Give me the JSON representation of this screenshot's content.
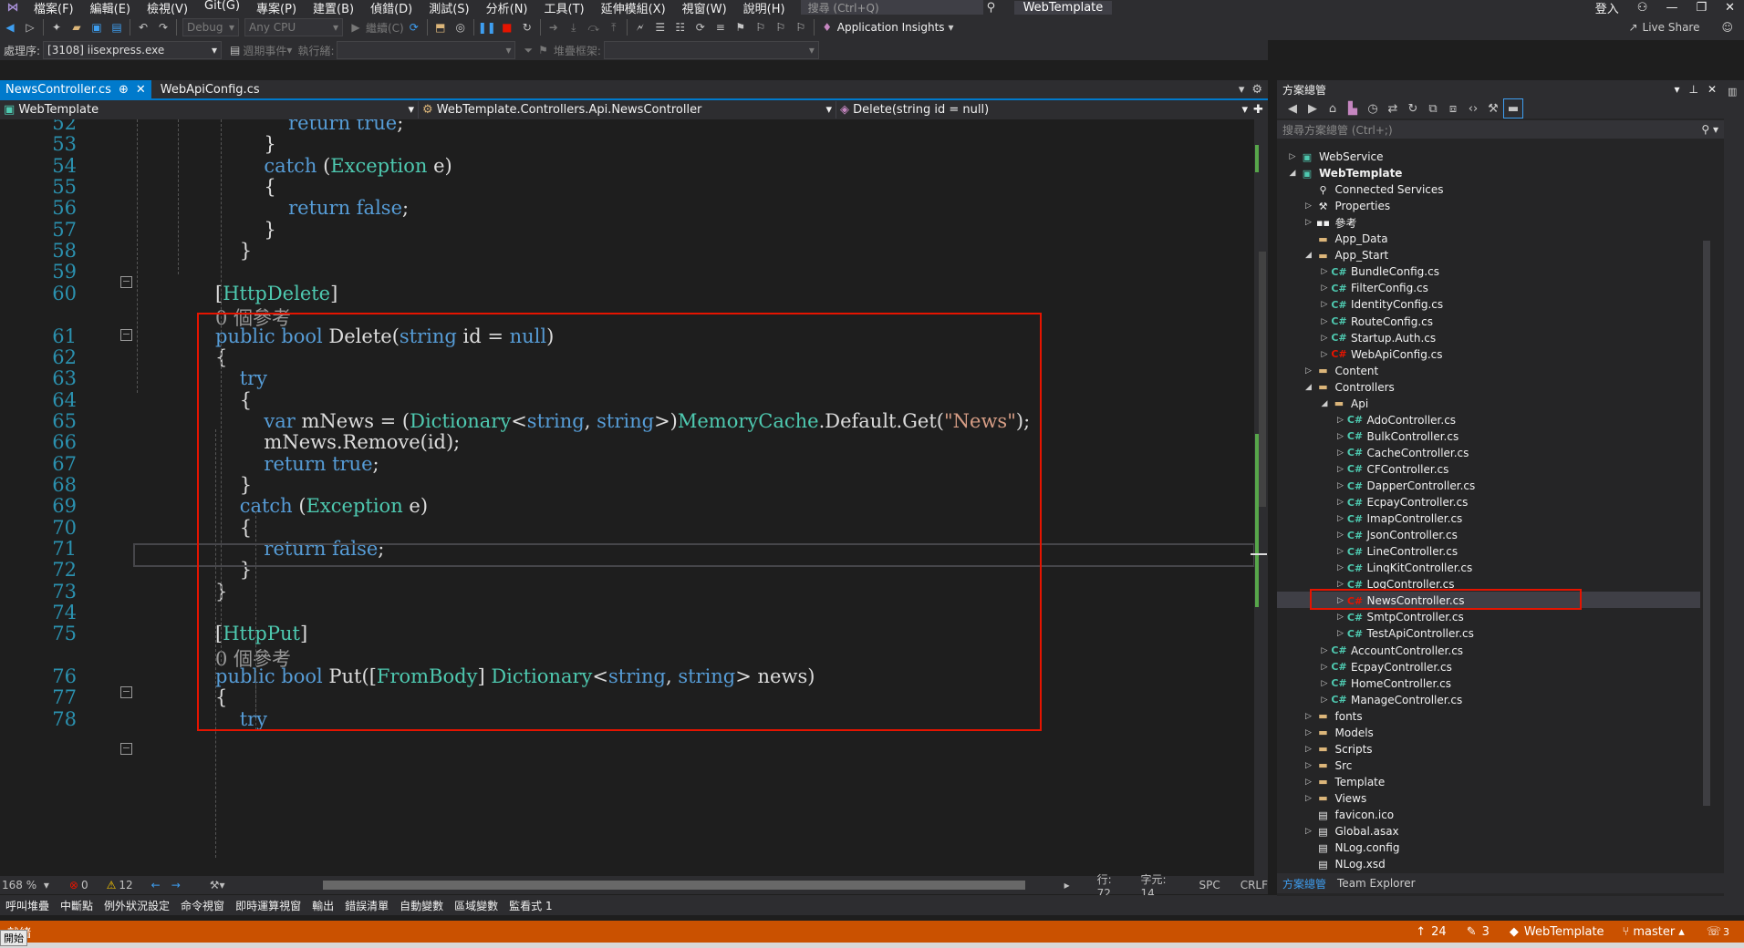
{
  "menu": {
    "items": [
      "檔案(F)",
      "編輯(E)",
      "檢視(V)",
      "Git(G)",
      "專案(P)",
      "建置(B)",
      "偵錯(D)",
      "測試(S)",
      "分析(N)",
      "工具(T)",
      "延伸模組(X)",
      "視窗(W)",
      "說明(H)"
    ],
    "search_placeholder": "搜尋 (Ctrl+Q)",
    "solution_title": "WebTemplate",
    "signin": "登入"
  },
  "toolbar": {
    "config": "Debug",
    "platform": "Any CPU",
    "continue": "繼續(C)",
    "app_insights": "Application Insights",
    "live_share": "Live Share",
    "process_label": "處理序:",
    "process": "[3108] iisexpress.exe",
    "lifecycle": "週期事件",
    "thread_label": "執行緒:",
    "stack_label": "堆疊框架:"
  },
  "tabs": [
    {
      "label": "NewsController.cs",
      "pin": "⊕",
      "active": true
    },
    {
      "label": "WebApiConfig.cs",
      "active": false
    }
  ],
  "nav": {
    "project": "WebTemplate",
    "class": "WebTemplate.Controllers.Api.NewsController",
    "member": "Delete(string id = null)"
  },
  "status_edit": {
    "zoom": "168 %",
    "errors": "0",
    "warnings": "12",
    "line": "行: 72",
    "char": "字元: 14",
    "spc": "SPC",
    "crlf": "CRLF"
  },
  "bottom_tabs": [
    "呼叫堆疊",
    "中斷點",
    "例外狀況設定",
    "命令視窗",
    "即時運算視窗",
    "輸出",
    "錯誤清單",
    "自動變數",
    "區域變數",
    "監看式 1"
  ],
  "statusbar": {
    "ready": "就緒",
    "up": "24",
    "edits": "3",
    "repo": "WebTemplate",
    "branch": "master",
    "notif": "3",
    "start": "開始"
  },
  "solution": {
    "title": "方案總管",
    "search": "搜尋方案總管 (Ctrl+;)",
    "items": [
      {
        "label": "WebService",
        "lvl": 0,
        "arrow": "▷",
        "icon": "proj"
      },
      {
        "label": "WebTemplate",
        "lvl": 0,
        "arrow": "◢",
        "icon": "proj",
        "bold": true
      },
      {
        "label": "Connected Services",
        "lvl": 1,
        "arrow": "",
        "icon": "svc"
      },
      {
        "label": "Properties",
        "lvl": 1,
        "arrow": "▷",
        "icon": "wrench"
      },
      {
        "label": "參考",
        "lvl": 1,
        "arrow": "▷",
        "icon": "ref"
      },
      {
        "label": "App_Data",
        "lvl": 1,
        "arrow": "",
        "icon": "folder"
      },
      {
        "label": "App_Start",
        "lvl": 1,
        "arrow": "◢",
        "icon": "folder"
      },
      {
        "label": "BundleConfig.cs",
        "lvl": 2,
        "arrow": "▷",
        "icon": "cs"
      },
      {
        "label": "FilterConfig.cs",
        "lvl": 2,
        "arrow": "▷",
        "icon": "cs"
      },
      {
        "label": "IdentityConfig.cs",
        "lvl": 2,
        "arrow": "▷",
        "icon": "cs"
      },
      {
        "label": "RouteConfig.cs",
        "lvl": 2,
        "arrow": "▷",
        "icon": "cs"
      },
      {
        "label": "Startup.Auth.cs",
        "lvl": 2,
        "arrow": "▷",
        "icon": "cs"
      },
      {
        "label": "WebApiConfig.cs",
        "lvl": 2,
        "arrow": "▷",
        "icon": "cs-edit"
      },
      {
        "label": "Content",
        "lvl": 1,
        "arrow": "▷",
        "icon": "folder"
      },
      {
        "label": "Controllers",
        "lvl": 1,
        "arrow": "◢",
        "icon": "folder"
      },
      {
        "label": "Api",
        "lvl": 2,
        "arrow": "◢",
        "icon": "folder"
      },
      {
        "label": "AdoController.cs",
        "lvl": 3,
        "arrow": "▷",
        "icon": "cs"
      },
      {
        "label": "BulkController.cs",
        "lvl": 3,
        "arrow": "▷",
        "icon": "cs"
      },
      {
        "label": "CacheController.cs",
        "lvl": 3,
        "arrow": "▷",
        "icon": "cs"
      },
      {
        "label": "CFController.cs",
        "lvl": 3,
        "arrow": "▷",
        "icon": "cs"
      },
      {
        "label": "DapperController.cs",
        "lvl": 3,
        "arrow": "▷",
        "icon": "cs"
      },
      {
        "label": "EcpayController.cs",
        "lvl": 3,
        "arrow": "▷",
        "icon": "cs"
      },
      {
        "label": "ImapController.cs",
        "lvl": 3,
        "arrow": "▷",
        "icon": "cs"
      },
      {
        "label": "JsonController.cs",
        "lvl": 3,
        "arrow": "▷",
        "icon": "cs"
      },
      {
        "label": "LineController.cs",
        "lvl": 3,
        "arrow": "▷",
        "icon": "cs"
      },
      {
        "label": "LinqKitController.cs",
        "lvl": 3,
        "arrow": "▷",
        "icon": "cs"
      },
      {
        "label": "LogController.cs",
        "lvl": 3,
        "arrow": "▷",
        "icon": "cs"
      },
      {
        "label": "NewsController.cs",
        "lvl": 3,
        "arrow": "▷",
        "icon": "cs-edit",
        "selected": true
      },
      {
        "label": "SmtpController.cs",
        "lvl": 3,
        "arrow": "▷",
        "icon": "cs"
      },
      {
        "label": "TestApiController.cs",
        "lvl": 3,
        "arrow": "▷",
        "icon": "cs"
      },
      {
        "label": "AccountController.cs",
        "lvl": 2,
        "arrow": "▷",
        "icon": "cs"
      },
      {
        "label": "EcpayController.cs",
        "lvl": 2,
        "arrow": "▷",
        "icon": "cs"
      },
      {
        "label": "HomeController.cs",
        "lvl": 2,
        "arrow": "▷",
        "icon": "cs"
      },
      {
        "label": "ManageController.cs",
        "lvl": 2,
        "arrow": "▷",
        "icon": "cs"
      },
      {
        "label": "fonts",
        "lvl": 1,
        "arrow": "▷",
        "icon": "folder"
      },
      {
        "label": "Models",
        "lvl": 1,
        "arrow": "▷",
        "icon": "folder"
      },
      {
        "label": "Scripts",
        "lvl": 1,
        "arrow": "▷",
        "icon": "folder"
      },
      {
        "label": "Src",
        "lvl": 1,
        "arrow": "▷",
        "icon": "folder"
      },
      {
        "label": "Template",
        "lvl": 1,
        "arrow": "▷",
        "icon": "folder"
      },
      {
        "label": "Views",
        "lvl": 1,
        "arrow": "▷",
        "icon": "folder"
      },
      {
        "label": "favicon.ico",
        "lvl": 1,
        "arrow": "",
        "icon": "file"
      },
      {
        "label": "Global.asax",
        "lvl": 1,
        "arrow": "▷",
        "icon": "file"
      },
      {
        "label": "NLog.config",
        "lvl": 1,
        "arrow": "",
        "icon": "file"
      },
      {
        "label": "NLog.xsd",
        "lvl": 1,
        "arrow": "",
        "icon": "file"
      }
    ],
    "bottom_tabs": [
      "方案總管",
      "Team Explorer"
    ]
  },
  "code": [
    {
      "n": "52",
      "t": [
        [
          "            ",
          ""
        ],
        [
          "return ",
          "kw"
        ],
        [
          "true",
          "kw"
        ],
        [
          ";",
          ""
        ]
      ]
    },
    {
      "n": "53",
      "t": [
        [
          "        }",
          ""
        ]
      ]
    },
    {
      "n": "54",
      "t": [
        [
          "        ",
          ""
        ],
        [
          "catch ",
          "kw"
        ],
        [
          "(",
          ""
        ],
        [
          "Exception ",
          "ty"
        ],
        [
          "e",
          ""
        ],
        [
          ")",
          ""
        ]
      ]
    },
    {
      "n": "55",
      "t": [
        [
          "        {",
          ""
        ]
      ]
    },
    {
      "n": "56",
      "t": [
        [
          "            ",
          ""
        ],
        [
          "return ",
          "kw"
        ],
        [
          "false",
          "kw"
        ],
        [
          ";",
          ""
        ]
      ]
    },
    {
      "n": "57",
      "t": [
        [
          "        }",
          ""
        ]
      ]
    },
    {
      "n": "58",
      "t": [
        [
          "    }",
          ""
        ]
      ]
    },
    {
      "n": "59",
      "t": [
        [
          "",
          ""
        ]
      ]
    },
    {
      "n": "60",
      "t": [
        [
          "[",
          ""
        ],
        [
          "HttpDelete",
          "at"
        ],
        [
          "]",
          ""
        ]
      ]
    },
    {
      "n": "",
      "t": [
        [
          "0 個參考",
          "ref"
        ]
      ]
    },
    {
      "n": "61",
      "t": [
        [
          "public ",
          "kw"
        ],
        [
          "bool ",
          "kw"
        ],
        [
          "Delete",
          ""
        ],
        [
          "(",
          ""
        ],
        [
          "string ",
          "kw"
        ],
        [
          "id = ",
          ""
        ],
        [
          "null",
          "kw"
        ],
        [
          ")",
          ""
        ]
      ]
    },
    {
      "n": "62",
      "t": [
        [
          "{",
          ""
        ]
      ]
    },
    {
      "n": "63",
      "t": [
        [
          "    ",
          ""
        ],
        [
          "try",
          "kw"
        ]
      ]
    },
    {
      "n": "64",
      "t": [
        [
          "    {",
          ""
        ]
      ]
    },
    {
      "n": "65",
      "t": [
        [
          "        ",
          ""
        ],
        [
          "var ",
          "kw"
        ],
        [
          "mNews = (",
          ""
        ],
        [
          "Dictionary",
          "ty"
        ],
        [
          "<",
          ""
        ],
        [
          "string",
          "kw"
        ],
        [
          ", ",
          ""
        ],
        [
          "string",
          "kw"
        ],
        [
          ">)",
          ""
        ],
        [
          "MemoryCache",
          "ty"
        ],
        [
          ".Default.Get(",
          ""
        ],
        [
          "\"News\"",
          "st"
        ],
        [
          ");",
          ""
        ]
      ]
    },
    {
      "n": "66",
      "t": [
        [
          "        mNews.Remove(id);",
          ""
        ]
      ]
    },
    {
      "n": "67",
      "t": [
        [
          "        ",
          ""
        ],
        [
          "return ",
          "kw"
        ],
        [
          "true",
          "kw"
        ],
        [
          ";",
          ""
        ]
      ]
    },
    {
      "n": "68",
      "t": [
        [
          "    }",
          ""
        ]
      ]
    },
    {
      "n": "69",
      "t": [
        [
          "    ",
          ""
        ],
        [
          "catch ",
          "kw"
        ],
        [
          "(",
          ""
        ],
        [
          "Exception ",
          "ty"
        ],
        [
          "e",
          ""
        ],
        [
          ")",
          ""
        ]
      ]
    },
    {
      "n": "70",
      "t": [
        [
          "    {",
          ""
        ]
      ]
    },
    {
      "n": "71",
      "t": [
        [
          "        ",
          ""
        ],
        [
          "return ",
          "kw"
        ],
        [
          "false",
          "kw"
        ],
        [
          ";",
          ""
        ]
      ]
    },
    {
      "n": "72",
      "t": [
        [
          "    }",
          ""
        ]
      ]
    },
    {
      "n": "73",
      "t": [
        [
          "}",
          ""
        ]
      ]
    },
    {
      "n": "74",
      "t": [
        [
          "",
          ""
        ]
      ]
    },
    {
      "n": "75",
      "t": [
        [
          "[",
          ""
        ],
        [
          "HttpPut",
          "at"
        ],
        [
          "]",
          ""
        ]
      ]
    },
    {
      "n": "",
      "t": [
        [
          "0 個參考",
          "ref"
        ]
      ]
    },
    {
      "n": "76",
      "t": [
        [
          "public ",
          "kw"
        ],
        [
          "bool ",
          "kw"
        ],
        [
          "Put",
          ""
        ],
        [
          "([",
          ""
        ],
        [
          "FromBody",
          "ty"
        ],
        [
          "] ",
          ""
        ],
        [
          "Dictionary",
          "ty"
        ],
        [
          "<",
          ""
        ],
        [
          "string",
          "kw"
        ],
        [
          ", ",
          ""
        ],
        [
          "string",
          "kw"
        ],
        [
          "> news)",
          ""
        ]
      ]
    },
    {
      "n": "77",
      "t": [
        [
          "{",
          ""
        ]
      ]
    },
    {
      "n": "78",
      "t": [
        [
          "    ",
          ""
        ],
        [
          "try",
          "kw"
        ]
      ]
    }
  ]
}
